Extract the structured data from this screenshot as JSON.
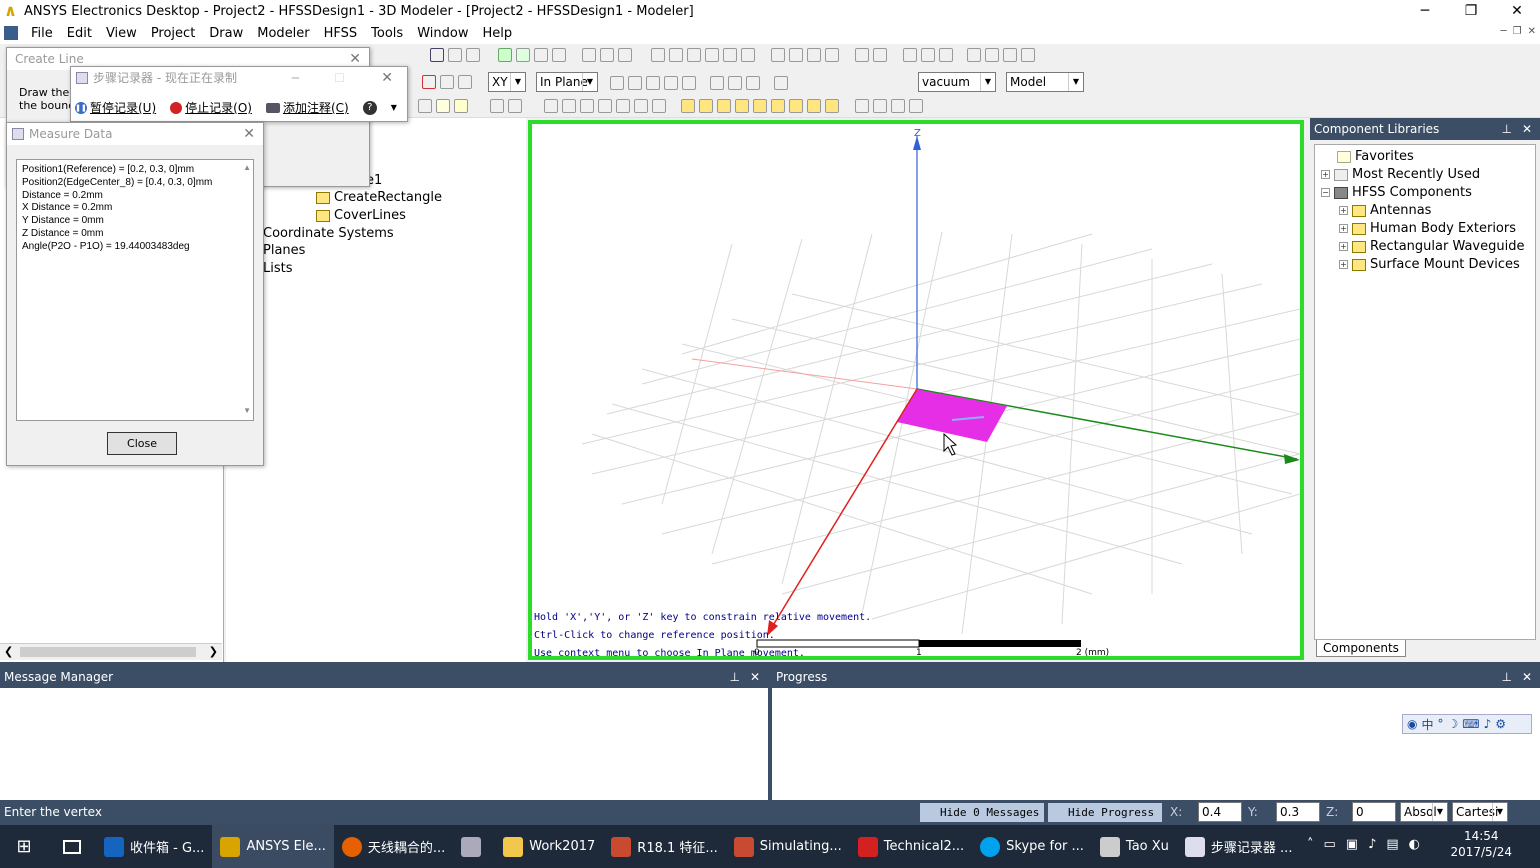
{
  "window": {
    "title": "ANSYS Electronics Desktop - Project2 - HFSSDesign1 - 3D Modeler - [Project2 - HFSSDesign1 - Modeler]"
  },
  "menu": [
    "File",
    "Edit",
    "View",
    "Project",
    "Draw",
    "Modeler",
    "HFSS",
    "Tools",
    "Window",
    "Help"
  ],
  "toolbar": {
    "plane": "XY",
    "mode": "In Plane",
    "material": "vacuum",
    "model": "Model"
  },
  "create_line": {
    "title": "Create Line",
    "text1": "Draw the lir",
    "text2": "the bounde"
  },
  "recorder": {
    "title": "步骤记录器 - 现在正在录制",
    "pause": "暂停记录(U)",
    "stop": "停止记录(O)",
    "comment": "添加注释(C)"
  },
  "measure": {
    "title": "Measure Data",
    "lines": [
      "Position1(Reference) = [0.2, 0.3, 0]mm",
      "Position2(EdgeCenter_8) = [0.4, 0.3, 0]mm",
      "Distance = 0.2mm",
      "X Distance = 0.2mm",
      "Y Distance = 0mm",
      "Z Distance = 0mm",
      "Angle(P2O - P1O) = 19.44003483deg"
    ],
    "close": "Close"
  },
  "tree": {
    "partial": "e1",
    "create_rect": "CreateRectangle",
    "cover_lines": "CoverLines",
    "coord_sys": "Coordinate Systems",
    "planes": "Planes",
    "lists": "Lists"
  },
  "viewport": {
    "axis_z": "Z",
    "hint1": "Hold 'X','Y', or 'Z' key to constrain relative movement.",
    "hint2": "Ctrl-Click to change reference position.",
    "hint3": "Use context menu to choose In Plane movement.",
    "scale0": "0",
    "scale1": "1",
    "scale2": "2 (mm)",
    "colors": {
      "border": "#2bdc2b",
      "rect": "#e62ee6",
      "x_axis": "#e02020",
      "y_axis": "#1a8a1a",
      "z_axis": "#3060e0"
    }
  },
  "libraries": {
    "title": "Component Libraries",
    "items": [
      "Favorites",
      "Most Recently Used",
      "HFSS Components",
      "Antennas",
      "Human Body Exteriors",
      "Rectangular Waveguide",
      "Surface Mount Devices"
    ],
    "tab": "Components"
  },
  "message_manager": {
    "title": "Message Manager"
  },
  "progress": {
    "title": "Progress"
  },
  "status": {
    "text": "Enter the vertex",
    "hide_messages": "Hide 0 Messages",
    "hide_progress": "Hide Progress",
    "x_label": "X:",
    "x_val": "0.4",
    "y_label": "Y:",
    "y_val": "0.3",
    "z_label": "Z:",
    "z_val": "0",
    "abs": "Absol",
    "cart": "Cartesi"
  },
  "taskbar": {
    "items": [
      "收件箱 - G...",
      "ANSYS Ele...",
      "天线耦合的...",
      "",
      "Work2017",
      "R18.1 特征...",
      "Simulating...",
      "Technical2...",
      "Skype for ...",
      "Tao Xu",
      "步骤记录器 ..."
    ],
    "time": "14:54",
    "date": "2017/5/24"
  }
}
